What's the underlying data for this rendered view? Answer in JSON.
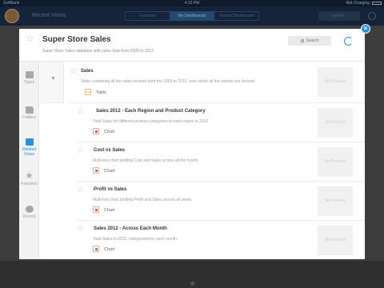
{
  "status_bar": {
    "carrier": "SoftBank",
    "time": "4:10 PM",
    "battery": "Not Charging"
  },
  "background": {
    "title": "Recent Views",
    "segments": [
      "Favorites",
      "My Dashboards",
      "Shared Dashboards"
    ],
    "active_segment": 1,
    "search_placeholder": "Search"
  },
  "modal": {
    "title": "Super Store Sales",
    "subtitle": "Super Store Sales database with sales data from 2009 to 2012",
    "search_label": "Search",
    "sidebar": [
      {
        "label": "Types",
        "icon": "document-icon",
        "active": false
      },
      {
        "label": "Folders",
        "icon": "folder-icon",
        "active": false
      },
      {
        "label": "Related Views",
        "icon": "related-views-icon",
        "active": true
      },
      {
        "label": "Favorites",
        "icon": "star-icon",
        "active": false
      },
      {
        "label": "Recent",
        "icon": "clock-icon",
        "active": false
      }
    ],
    "items": [
      {
        "title": "Sales",
        "description": "Table containing all the sales records from the 2009 to 2012, over which all the reports are derived.",
        "type": "Table",
        "preview": "No Preview"
      },
      {
        "title": "Sales 2012 - Each Region and Product Category",
        "description": "Total Sales for different product categories in each region in 2012",
        "type": "Chart",
        "preview": "No Preview"
      },
      {
        "title": "Cost vs Sales",
        "description": "Multi-line chart plotting Cost and Sales across all the month",
        "type": "Chart",
        "preview": "No Preview"
      },
      {
        "title": "Profit vs Sales",
        "description": "Multi-line chart plotting Profit and Sales across all years.",
        "type": "Chart",
        "preview": "No Preview"
      },
      {
        "title": "Sales 2012 - Across Each Month",
        "description": "Total Sales in 2012, categorized by each month",
        "type": "Chart",
        "preview": "No Preview"
      }
    ]
  },
  "colors": {
    "accent": "#2a8fd6",
    "header": "#13243a",
    "modal_bg": "#ffffff"
  }
}
